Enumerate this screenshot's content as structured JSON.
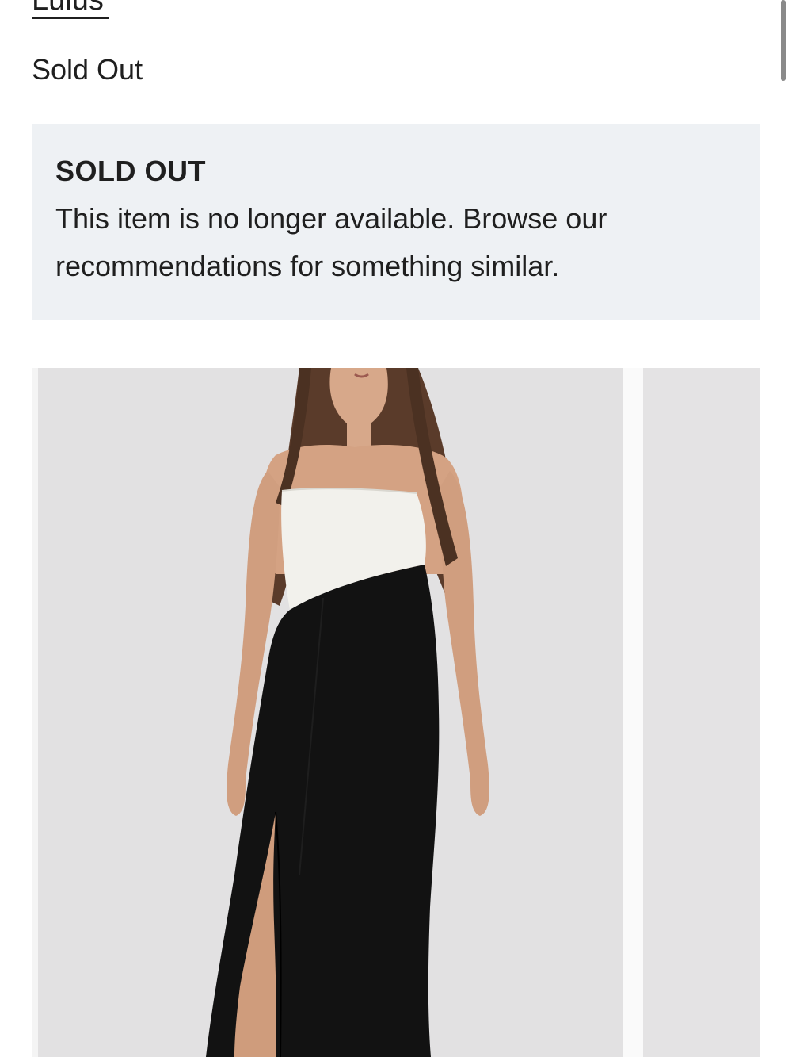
{
  "product": {
    "brand": "Lulus",
    "availability": "Sold Out"
  },
  "notice": {
    "title": "SOLD OUT",
    "message": "This item is no longer available. Browse our recommendations for something similar."
  },
  "gallery": {
    "images": [
      {
        "alt": "Model wearing a strapless black and ivory column gown with a front slit"
      },
      {
        "alt": "Next product image"
      }
    ]
  },
  "colors": {
    "notice_background": "#eef1f4",
    "text": "#1f1f1f",
    "photo_background": "#e2e1e2"
  }
}
